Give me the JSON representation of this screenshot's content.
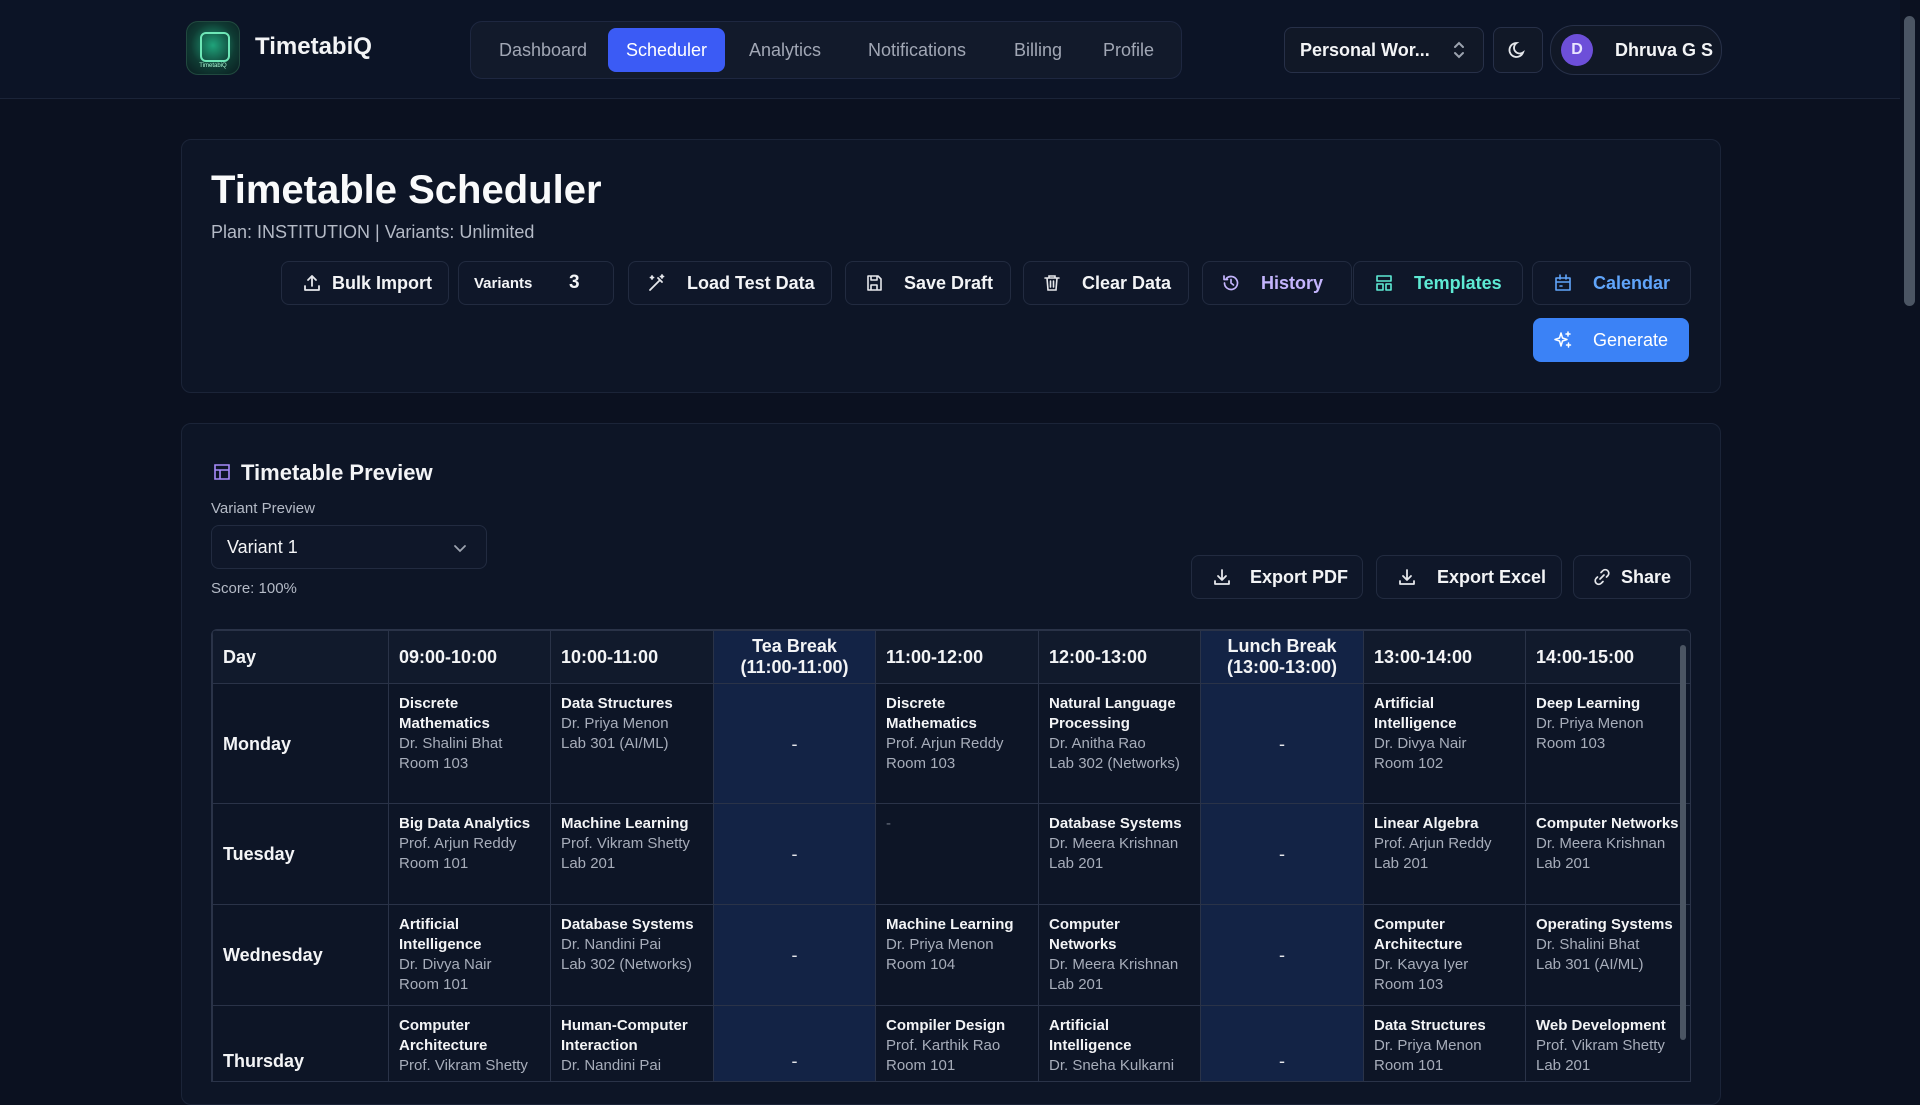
{
  "app": {
    "brand": "TimetabiQ",
    "logo_text": "TimetabiQ"
  },
  "nav": {
    "items": [
      "Dashboard",
      "Scheduler",
      "Analytics",
      "Notifications",
      "Billing",
      "Profile"
    ],
    "active": "Scheduler"
  },
  "header": {
    "workspace": "Personal Wor...",
    "user_initial": "D",
    "user_name": "Dhruva G S"
  },
  "page": {
    "title": "Timetable Scheduler",
    "subtitle": "Plan: INSTITUTION | Variants: Unlimited"
  },
  "toolbar": {
    "bulk_import": "Bulk Import",
    "variants_label": "Variants",
    "variants_value": "3",
    "load_test_data": "Load Test Data",
    "save_draft": "Save Draft",
    "clear_data": "Clear Data",
    "history": "History",
    "templates": "Templates",
    "calendar": "Calendar",
    "generate": "Generate"
  },
  "preview": {
    "title": "Timetable Preview",
    "variant_label": "Variant Preview",
    "variant_selected": "Variant 1",
    "score": "Score: 100%",
    "export_pdf": "Export PDF",
    "export_excel": "Export Excel",
    "share": "Share"
  },
  "timetable": {
    "headers": [
      "Day",
      "09:00-10:00",
      "10:00-11:00",
      "Tea Break (11:00-11:00)",
      "11:00-12:00",
      "12:00-13:00",
      "Lunch Break (13:00-13:00)",
      "13:00-14:00",
      "14:00-15:00"
    ],
    "break_marker": "-",
    "empty_marker": "-",
    "rows": [
      {
        "day": "Monday",
        "cells": [
          {
            "subject": "Discrete Mathematics",
            "teacher": "Dr. Shalini Bhat",
            "room": "Room 103"
          },
          {
            "subject": "Data Structures",
            "teacher": "Dr. Priya Menon",
            "room": "Lab 301 (AI/ML)"
          },
          {
            "subject": "Discrete Mathematics",
            "teacher": "Prof. Arjun Reddy",
            "room": "Room 103"
          },
          {
            "subject": "Natural Language Processing",
            "teacher": "Dr. Anitha Rao",
            "room": "Lab 302 (Networks)"
          },
          {
            "subject": "Artificial Intelligence",
            "teacher": "Dr. Divya Nair",
            "room": "Room 102"
          },
          {
            "subject": "Deep Learning",
            "teacher": "Dr. Priya Menon",
            "room": "Room 103"
          }
        ]
      },
      {
        "day": "Tuesday",
        "cells": [
          {
            "subject": "Big Data Analytics",
            "teacher": "Prof. Arjun Reddy",
            "room": "Room 101"
          },
          {
            "subject": "Machine Learning",
            "teacher": "Prof. Vikram Shetty",
            "room": "Lab 201"
          },
          null,
          {
            "subject": "Database Systems",
            "teacher": "Dr. Meera Krishnan",
            "room": "Lab 201"
          },
          {
            "subject": "Linear Algebra",
            "teacher": "Prof. Arjun Reddy",
            "room": "Lab 201"
          },
          {
            "subject": "Computer Networks",
            "teacher": "Dr. Meera Krishnan",
            "room": "Lab 201"
          }
        ]
      },
      {
        "day": "Wednesday",
        "cells": [
          {
            "subject": "Artificial Intelligence",
            "teacher": "Dr. Divya Nair",
            "room": "Room 101"
          },
          {
            "subject": "Database Systems",
            "teacher": "Dr. Nandini Pai",
            "room": "Lab 302 (Networks)"
          },
          {
            "subject": "Machine Learning",
            "teacher": "Dr. Priya Menon",
            "room": "Room 104"
          },
          {
            "subject": "Computer Networks",
            "teacher": "Dr. Meera Krishnan",
            "room": "Lab 201"
          },
          {
            "subject": "Computer Architecture",
            "teacher": "Dr. Kavya Iyer",
            "room": "Room 103"
          },
          {
            "subject": "Operating Systems",
            "teacher": "Dr. Shalini Bhat",
            "room": "Lab 301 (AI/ML)"
          }
        ]
      },
      {
        "day": "Thursday",
        "cells": [
          {
            "subject": "Computer Architecture",
            "teacher": "Prof. Vikram Shetty",
            "room": ""
          },
          {
            "subject": "Human-Computer Interaction",
            "teacher": "Dr. Nandini Pai",
            "room": ""
          },
          {
            "subject": "Compiler Design",
            "teacher": "Prof. Karthik Rao",
            "room": "Room 101"
          },
          {
            "subject": "Artificial Intelligence",
            "teacher": "Dr. Sneha Kulkarni",
            "room": ""
          },
          {
            "subject": "Data Structures",
            "teacher": "Dr. Priya Menon",
            "room": "Room 101"
          },
          {
            "subject": "Web Development",
            "teacher": "Prof. Vikram Shetty",
            "room": "Lab 201"
          }
        ]
      }
    ]
  },
  "colors": {
    "accent": "#3b5bf5",
    "generate": "#3b82f6",
    "history": "#c4b5fd",
    "templates": "#5eead4",
    "calendar": "#60a5fa"
  }
}
